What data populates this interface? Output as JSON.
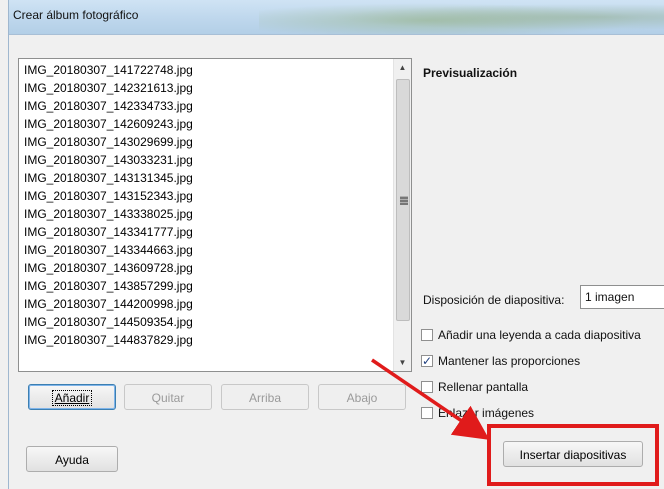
{
  "window": {
    "title": "Crear álbum fotográfico"
  },
  "files": [
    "IMG_20180307_141722748.jpg",
    "IMG_20180307_142321613.jpg",
    "IMG_20180307_142334733.jpg",
    "IMG_20180307_142609243.jpg",
    "IMG_20180307_143029699.jpg",
    "IMG_20180307_143033231.jpg",
    "IMG_20180307_143131345.jpg",
    "IMG_20180307_143152343.jpg",
    "IMG_20180307_143338025.jpg",
    "IMG_20180307_143341777.jpg",
    "IMG_20180307_143344663.jpg",
    "IMG_20180307_143609728.jpg",
    "IMG_20180307_143857299.jpg",
    "IMG_20180307_144200998.jpg",
    "IMG_20180307_144509354.jpg",
    "IMG_20180307_144837829.jpg"
  ],
  "buttons": {
    "add": "Añadir",
    "remove": "Quitar",
    "up": "Arriba",
    "down": "Abajo",
    "help": "Ayuda",
    "insert": "Insertar diapositivas"
  },
  "preview": {
    "label": "Previsualización"
  },
  "layout": {
    "label": "Disposición de diapositiva:",
    "value": "1 imagen"
  },
  "options": {
    "caption": {
      "label": "Añadir una leyenda a cada diapositiva",
      "checked": false
    },
    "keep_ratio": {
      "label": "Mantener las proporciones",
      "checked": true
    },
    "fill_screen": {
      "label": "Rellenar pantalla",
      "checked": false
    },
    "link_images": {
      "label": "Enlazar imágenes",
      "checked": false
    }
  },
  "colors": {
    "highlight": "#e01b1b"
  }
}
